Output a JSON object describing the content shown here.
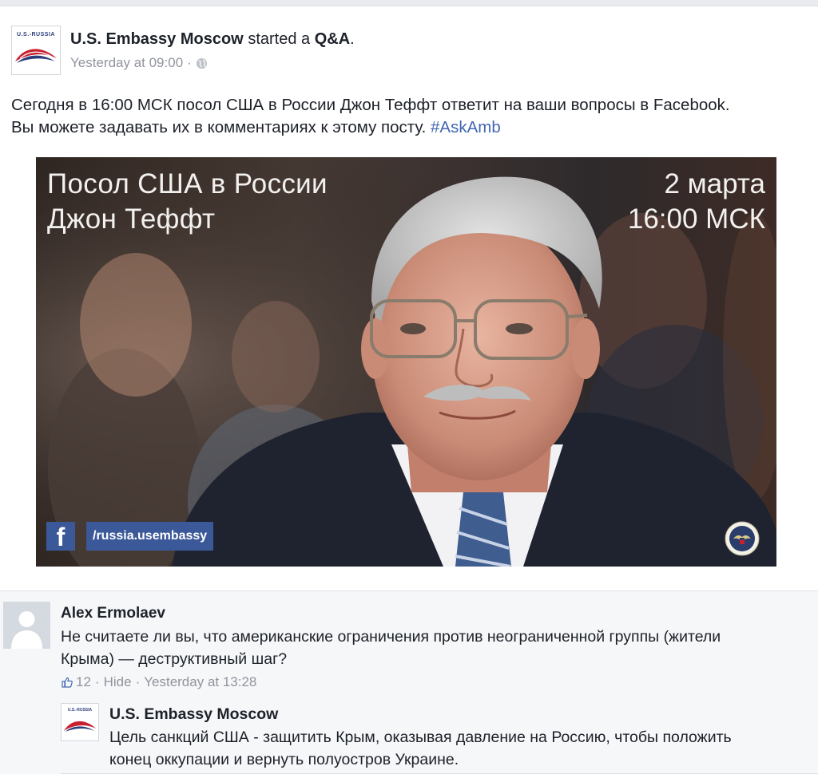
{
  "post": {
    "author": "U.S. Embassy Moscow",
    "action": "started a",
    "post_type": "Q&A",
    "punct": ".",
    "timestamp": "Yesterday at 09:00",
    "dot": "·",
    "avatar_text": "U.S.-RUSSIA",
    "privacy_icon": "globe-icon",
    "text_line1": "Сегодня в 16:00 МСК посол США в России Джон Теффт ответит на ваши вопросы в Facebook.",
    "text_line2_prefix": "Вы можете задавать их в комментариях к этому посту.",
    "hashtag": "#AskAmb"
  },
  "promo_image": {
    "title_line1": "Посол США в России",
    "title_line2": "Джон Теффт",
    "date_line1": "2 марта",
    "date_line2": "16:00 МСК",
    "fb_glyph": "f",
    "handle": "/russia.usembassy",
    "fb_color": "#3b5998"
  },
  "comment": {
    "author": "Alex Ermolaev",
    "text_line1": "Не считаете ли вы, что американские ограничения против неограниченной группы (жители",
    "text_line2": "Крыма) — деструктивный шаг?",
    "like_count": "12",
    "hide_label": "Hide",
    "dot": "·",
    "timestamp": "Yesterday at 13:28"
  },
  "reply": {
    "author": "U.S. Embassy Moscow",
    "avatar_text": "U.S.-RUSSIA",
    "text_line1": "Цель санкций США - защитить Крым, оказывая давление на Россию, чтобы положить",
    "text_line2": "конец оккупации и вернуть полуостров Украине."
  },
  "colors": {
    "link": "#4267b2",
    "meta": "#90949c",
    "text": "#1d2129",
    "comments_bg": "#f6f7f9"
  }
}
